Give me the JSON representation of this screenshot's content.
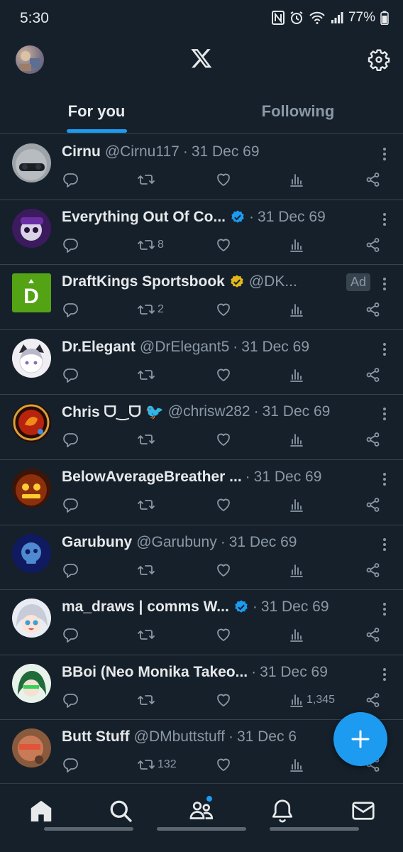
{
  "status_bar": {
    "time": "5:30",
    "battery": "77%"
  },
  "header": {
    "logo": "x-logo-icon",
    "settings_icon": "gear-icon"
  },
  "tabs": [
    {
      "label": "For you",
      "active": true
    },
    {
      "label": "Following",
      "active": false
    }
  ],
  "posts": [
    {
      "name": "Cirnu",
      "handle": "@Cirnu117",
      "date": "31 Dec 69",
      "retweets": "",
      "views": "",
      "verified": false,
      "ad": false
    },
    {
      "name": "Everything Out Of Co...",
      "handle": "",
      "date": "31 Dec 69",
      "retweets": "8",
      "views": "",
      "verified": true,
      "verified_color": "#1d9bf0",
      "ad": false
    },
    {
      "name": "DraftKings Sportsbook",
      "handle": "@DK...",
      "date": "",
      "retweets": "2",
      "views": "",
      "verified": true,
      "verified_color": "#e2b719",
      "ad": true,
      "ad_label": "Ad"
    },
    {
      "name": "Dr.Elegant",
      "handle": "@DrElegant5",
      "date": "31 Dec 69",
      "retweets": "",
      "views": "",
      "verified": false,
      "ad": false
    },
    {
      "name": "Chris ᗜ‿ᗜ 🐦",
      "handle": "@chrisw282",
      "date": "31 Dec 69",
      "retweets": "",
      "views": "",
      "verified": false,
      "ad": false
    },
    {
      "name": "BelowAverageBreather ...",
      "handle": "",
      "date": "31 Dec 69",
      "retweets": "",
      "views": "",
      "verified": false,
      "ad": false
    },
    {
      "name": "Garubuny",
      "handle": "@Garubuny",
      "date": "31 Dec 69",
      "retweets": "",
      "views": "",
      "verified": false,
      "ad": false
    },
    {
      "name": "ma_draws | comms W...",
      "handle": "",
      "date": "31 Dec 69",
      "retweets": "",
      "views": "",
      "verified": true,
      "verified_color": "#1d9bf0",
      "ad": false
    },
    {
      "name": "BBoi (Neo Monika Takeo...",
      "handle": "",
      "date": "31 Dec 69",
      "retweets": "",
      "views": "1,345",
      "verified": false,
      "ad": false
    },
    {
      "name": "Butt Stuff",
      "handle": "@DMbuttstuff",
      "date": "31 Dec 6",
      "retweets": "132",
      "views": "",
      "verified": false,
      "ad": false
    }
  ],
  "fab": {
    "icon": "plus-icon"
  },
  "bottom_nav": [
    {
      "icon": "home-icon",
      "active": true
    },
    {
      "icon": "search-icon",
      "active": false
    },
    {
      "icon": "communities-icon",
      "active": false,
      "badge": true
    },
    {
      "icon": "bell-icon",
      "active": false
    },
    {
      "icon": "mail-icon",
      "active": false
    }
  ],
  "colors": {
    "background": "#15202b",
    "accent": "#1d9bf0",
    "text_secondary": "#8b98a5"
  }
}
